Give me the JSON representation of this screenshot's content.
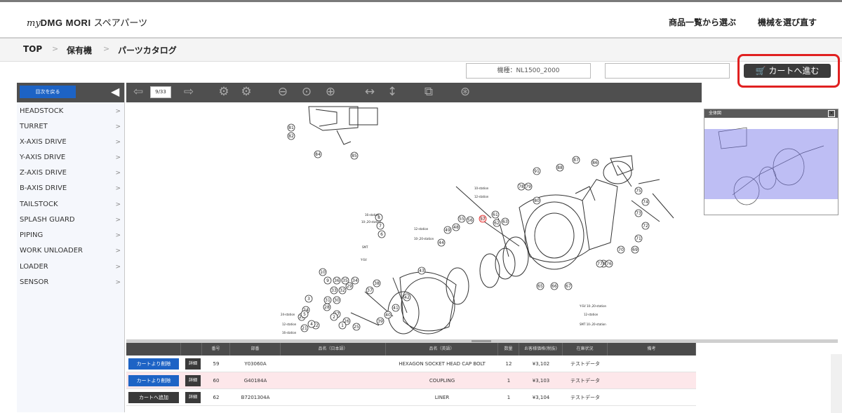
{
  "header": {
    "logo_my": "my",
    "logo_brand": "DMG MORI",
    "logo_sub": "スペアパーツ",
    "nav": [
      "商品一覧から選ぶ",
      "機械を選び直す"
    ]
  },
  "breadcrumb": [
    "TOP",
    "保有機",
    "パーツカタログ"
  ],
  "machine_label": "機種：NL1500_2000",
  "cart_button": "カートへ進む",
  "toolbar": {
    "page": "9/33"
  },
  "sidebar": {
    "button": "目次を戻る",
    "items": [
      "HEADSTOCK",
      "TURRET",
      "X-AXIS DRIVE",
      "Y-AXIS DRIVE",
      "Z-AXIS DRIVE",
      "B-AXIS DRIVE",
      "TAILSTOCK",
      "SPLASH GUARD",
      "PIPING",
      "WORK UNLOADER",
      "LOADER",
      "SENSOR"
    ]
  },
  "overview_title": "全体図",
  "diagram": {
    "callouts": [
      "81",
      "82",
      "84",
      "85",
      "91",
      "88",
      "87",
      "86",
      "78",
      "79",
      "80",
      "75",
      "74",
      "73",
      "72",
      "71",
      "70",
      "69",
      "68",
      "77",
      "76",
      "65",
      "66",
      "67",
      "63",
      "62",
      "61",
      "57",
      "55",
      "56",
      "49",
      "48",
      "44",
      "43",
      "42",
      "41",
      "40",
      "39",
      "38",
      "37",
      "36",
      "35",
      "34",
      "33",
      "32",
      "31",
      "30",
      "29",
      "28",
      "27",
      "26",
      "25",
      "24",
      "23",
      "22",
      "21",
      "10",
      "9",
      "8",
      "7",
      "6",
      "5",
      "4",
      "3",
      "2",
      "1"
    ],
    "highlighted_callout": "57",
    "labels": [
      "10-station",
      "12-station",
      "16-station",
      "10-,20-station",
      "12-station",
      "10-,20-station",
      "SMT",
      "Y-SV",
      "24-station",
      "12-station",
      "16-station",
      "Y-SV 10-,20-station",
      "12-station",
      "SMT 10-,20-station"
    ]
  },
  "table": {
    "headers": [
      "",
      "",
      "番号",
      "部番",
      "品名（日本語）",
      "品名（英語）",
      "数量",
      "お客様価格(税抜)",
      "在庫状況",
      "備考"
    ],
    "rows": [
      {
        "cart": "カートより削除",
        "detail": "詳細",
        "no": "59",
        "part": "Y03060A",
        "name_jp": "",
        "name_en": "HEXAGON SOCKET HEAD CAP BOLT",
        "qty": "12",
        "price": "¥3,102",
        "stock": "テストデータ",
        "note": ""
      },
      {
        "cart": "カートより削除",
        "detail": "詳細",
        "no": "60",
        "part": "G40184A",
        "name_jp": "",
        "name_en": "COUPLING",
        "qty": "1",
        "price": "¥3,103",
        "stock": "テストデータ",
        "note": ""
      },
      {
        "cart": "カートへ追加",
        "detail": "詳細",
        "no": "62",
        "part": "B7201304A",
        "name_jp": "",
        "name_en": "LINER",
        "qty": "1",
        "price": "¥3,104",
        "stock": "テストデータ",
        "note": ""
      }
    ]
  },
  "colors": {
    "accent_blue": "#1d63c5",
    "highlight_red": "#e02020",
    "selected_row": "#fde7ea",
    "overview_shade": "#8f8fe6"
  }
}
